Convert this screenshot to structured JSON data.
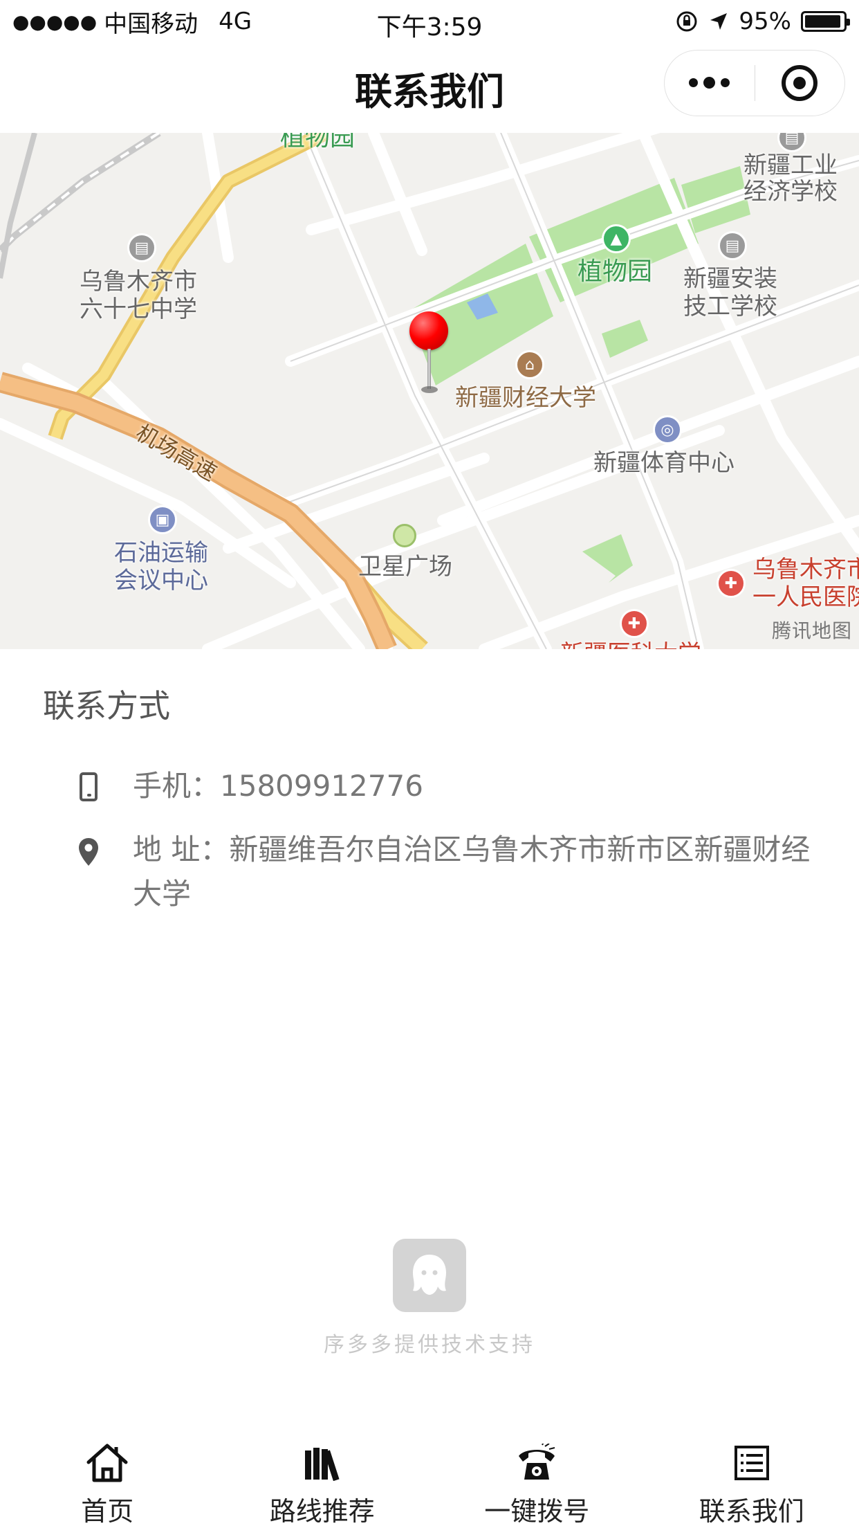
{
  "status_bar": {
    "carrier": "中国移动",
    "network": "4G",
    "time": "下午3:59",
    "battery": "95%",
    "battery_level": 0.95
  },
  "nav": {
    "title": "联系我们"
  },
  "map": {
    "labels": {
      "zhiwuyuan_top": "植物园",
      "xj_gongye_1": "新疆工业",
      "xj_gongye_2": "经济学校",
      "zhiwuyuan": "植物园",
      "xj_anzhuang_1": "新疆安装",
      "xj_anzhuang_2": "技工学校",
      "wlmq67_1": "乌鲁木齐市",
      "wlmq67_2": "六十七中学",
      "xj_caijing": "新疆财经大学",
      "jichang": "机场高速",
      "xj_tiyu": "新疆体育中心",
      "shiyou_1": "石油运输",
      "shiyou_2": "会议中心",
      "weixing": "卫星广场",
      "wlmq_hospital_1": "乌鲁木齐市",
      "wlmq_hospital_2": "一人民医院",
      "xj_yike": "新疆医科大学"
    },
    "watermark": "腾讯地图"
  },
  "contact": {
    "section_title": "联系方式",
    "phone_label": "手机：15809912776",
    "address_label": "地 址：新疆维吾尔自治区乌鲁木齐市新市区新疆财经大学"
  },
  "brand": {
    "text": "序多多提供技术支持"
  },
  "tabs": [
    {
      "label": "首页",
      "icon": "home-icon"
    },
    {
      "label": "路线推荐",
      "icon": "books-icon"
    },
    {
      "label": "一键拨号",
      "icon": "telephone-icon"
    },
    {
      "label": "联系我们",
      "icon": "list-icon"
    }
  ]
}
